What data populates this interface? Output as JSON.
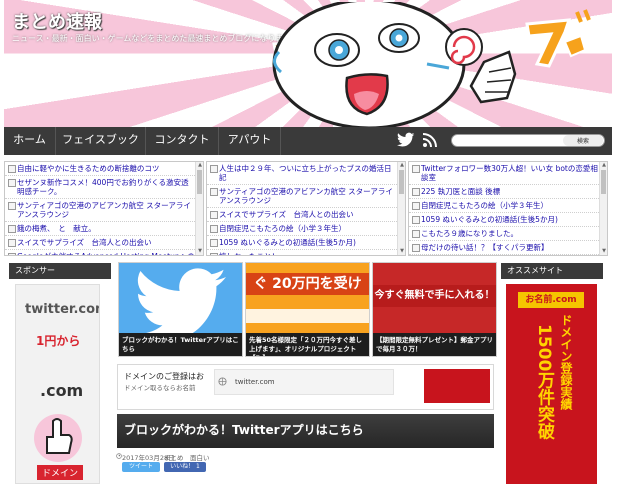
{
  "header": {
    "site_title": "まとめ速報",
    "site_description": "ニュース・最新・面白い・ゲームなどをまとめた最速まとめブログになります！"
  },
  "nav": {
    "items": [
      "ホーム",
      "フェイスブック",
      "コンタクト",
      "アパウト"
    ],
    "search_button": "検索"
  },
  "rss": {
    "left": [
      "自由に軽やかに生きるための断捨離のコツ",
      "セザンヌ新作コスメ！400円でお釣りがくる激安透明感チーク。",
      "サンティアゴの空港のアビアンカ航空 スターアライアンスラウンジ",
      "餓の梅煮、　と　献立。",
      "スイスでサプライズ　台湾人との出会い",
      "Googleが主催するAdvanced Hosting Meetupへの参加"
    ],
    "center": [
      "人生は中２９年、ついに立ち上がったブスの婚活日記",
      "サンティアゴの空港のアビアンカ航空 スターアライアンスラウンジ",
      "スイスでサプライズ　台湾人との出会い",
      "自閉症児こもたろの絵（小学３年生）",
      "1059 ぬいぐるみとの初通話(生後5か月)",
      "嬉しかったこと！",
      "アマゾン・ミニ・ホエール、ファミリークイズ"
    ],
    "right": [
      "Twitterフォロワー数30万人超！いい女 botの恋愛相談室",
      "225 執刀医と面談 後標",
      "自閉症児こもたろの絵（小学３年生）",
      "1059 ぬいぐるみとの初通話(生後5か月)",
      "こもたろ９歳になりました。",
      "母だけの待い話！？【すくパラ更新】",
      "聞いて！"
    ]
  },
  "sidebar_left": {
    "heading": "スポンサー",
    "ad_domain": "twitter.com",
    "ad_price": "1円から",
    "ad_tld": ".com",
    "ad_label": "ドメイン"
  },
  "sidebar_right": {
    "heading": "オススメサイト",
    "brand": "お名前.com",
    "vertical_text_1": "ドメイン登録実績",
    "vertical_text_2": "1500万件突破"
  },
  "thumbs": [
    {
      "caption": "ブロックがわかる！Twitterアプリはこちら",
      "overlay": ""
    },
    {
      "caption": "先着50名様限定「２０万円今すぐ差し上げます」、オリジナルプロジェクト【F-】",
      "overlay": "ぐ 20万円を受け"
    },
    {
      "caption": "【期間限定無料プレゼント】郵金アプリで毎月３０万！",
      "overlay": "今すぐ無料で手に入れる！"
    }
  ],
  "ad_strip": {
    "title": "ドメインのご登録はお",
    "subtitle": "ドメイン取るならお名前",
    "twitter_text": "twitter.com"
  },
  "article": {
    "title": "ブロックがわかる！Twitterアプリはこちら",
    "date": "2017年03月28日",
    "categories": "まとめ　面白い",
    "tweet": "ツイート",
    "like": "いいね！ 1"
  },
  "colors": {
    "nav_bg": "#3a3a3a",
    "header_pink": "#f7c6da",
    "twitter_blue": "#55acee",
    "ad_red": "#c8141d"
  }
}
